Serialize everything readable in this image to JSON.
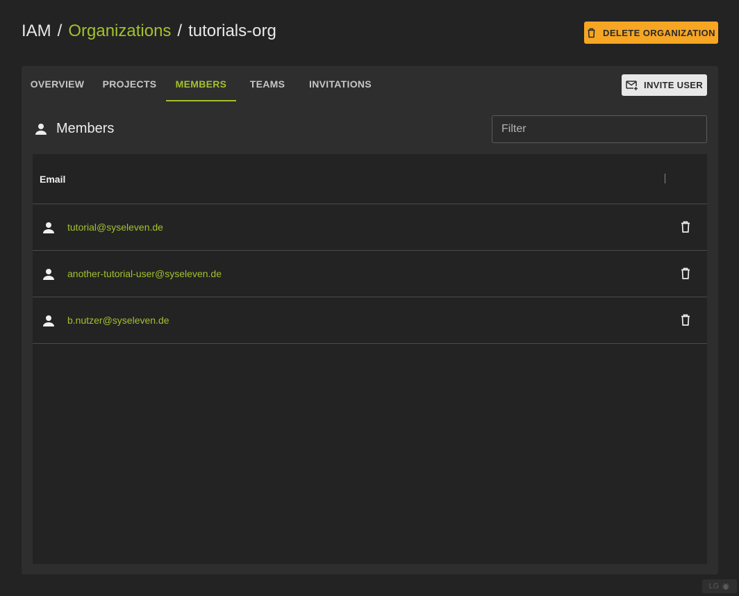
{
  "breadcrumb": {
    "root": "IAM",
    "separator": "/",
    "organizations": "Organizations",
    "current": "tutorials-org"
  },
  "actions": {
    "delete_organization": "DELETE ORGANIZATION",
    "invite_user": "INVITE USER"
  },
  "tabs": [
    {
      "label": "OVERVIEW",
      "active": false
    },
    {
      "label": "PROJECTS",
      "active": false
    },
    {
      "label": "MEMBERS",
      "active": true
    },
    {
      "label": "TEAMS",
      "active": false
    },
    {
      "label": "INVITATIONS",
      "active": false
    }
  ],
  "members": {
    "title": "Members",
    "filter_placeholder": "Filter",
    "columns": [
      "Email"
    ],
    "rows": [
      {
        "email": "tutorial@syseleven.de"
      },
      {
        "email": "another-tutorial-user@syseleven.de"
      },
      {
        "email": "b.nutzer@syseleven.de"
      }
    ]
  },
  "footer": {
    "badge": "LG"
  },
  "colors": {
    "accent": "#a3c12e",
    "warning": "#f6a623",
    "background": "#232323",
    "card": "#2e2e2e"
  },
  "icons": [
    "trash-icon",
    "mail-add-icon",
    "person-icon",
    "bug-icon"
  ]
}
